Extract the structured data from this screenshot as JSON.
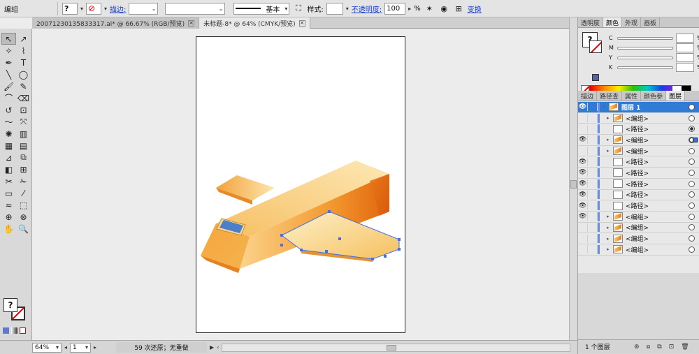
{
  "control_bar": {
    "selection_type": "编组",
    "fill_icon": "question-mark",
    "stroke_label": "描边:",
    "stroke_value": "",
    "stroke_profile_label": "基本",
    "style_label": "样式:",
    "opacity_label": "不透明度:",
    "opacity_value": "100",
    "opacity_unit": "%",
    "transform_label": "变换"
  },
  "tabs": [
    {
      "label": "20071230135833317.ai* @ 66.67% (RGB/预览)",
      "active": false
    },
    {
      "label": "未标题-8* @ 64% (CMYK/预览)",
      "active": true
    }
  ],
  "tools": [
    "selection-tool",
    "direct-selection-tool",
    "magic-wand-tool",
    "lasso-tool",
    "pen-tool",
    "type-tool",
    "line-tool",
    "ellipse-tool",
    "paintbrush-tool",
    "pencil-tool",
    "blob-brush-tool",
    "eraser-tool",
    "rotate-tool",
    "scale-tool",
    "warp-tool",
    "free-transform-tool",
    "symbol-sprayer-tool",
    "column-graph-tool",
    "mesh-tool",
    "gradient-tool",
    "eyedropper-tool",
    "blend-tool",
    "live-paint-bucket-tool",
    "live-paint-selection-tool",
    "slice-tool",
    "scissors-tool",
    "artboard-tool",
    "knife-tool",
    "width-tool",
    "shape-builder-tool",
    "perspective-grid-tool",
    "perspective-selection-tool",
    "hand-tool",
    "zoom-tool"
  ],
  "tool_glyphs": [
    "↖",
    "↗",
    "✧",
    "⌇",
    "✒",
    "T",
    "╲",
    "◯",
    "🖌",
    "✎",
    "⌒",
    "⌫",
    "↺",
    "⊡",
    "〜",
    "⤧",
    "✺",
    "▥",
    "▦",
    "▤",
    "⊿",
    "⧉",
    "◧",
    "⊞",
    "✂",
    "✁",
    "▭",
    "⁄",
    "≈",
    "⬚",
    "⊕",
    "⊗",
    "✋",
    "🔍"
  ],
  "fill_stroke": {
    "fill": "?",
    "stroke": "none"
  },
  "status": {
    "zoom": "64%",
    "artboard": "1",
    "undo_info": "59 次还原；无重做"
  },
  "panels": {
    "top_tabs": [
      {
        "label": "透明度",
        "active": false
      },
      {
        "label": "颜色",
        "active": true
      },
      {
        "label": "外观",
        "active": false
      },
      {
        "label": "画板",
        "active": false
      }
    ],
    "color_channels": [
      {
        "name": "C",
        "value": "",
        "unit": "%"
      },
      {
        "name": "M",
        "value": "",
        "unit": "%"
      },
      {
        "name": "Y",
        "value": "",
        "unit": "%"
      },
      {
        "name": "K",
        "value": "",
        "unit": "%"
      }
    ],
    "layer_tabs": [
      {
        "label": "描边",
        "active": false
      },
      {
        "label": "路径查",
        "active": false
      },
      {
        "label": "属性",
        "active": false
      },
      {
        "label": "颜色参",
        "active": false
      },
      {
        "label": "图层",
        "active": true
      }
    ],
    "layers": [
      {
        "name": "图层 1",
        "top": true,
        "visible": true,
        "expanded": true,
        "target": "outline"
      },
      {
        "name": "<编组>",
        "visible": false,
        "expandable": true,
        "target": "outline"
      },
      {
        "name": "<路径>",
        "visible": false,
        "expandable": false,
        "target": "filled"
      },
      {
        "name": "<编组>",
        "visible": true,
        "expandable": true,
        "target": "selected"
      },
      {
        "name": "<编组>",
        "visible": false,
        "expandable": true,
        "target": "outline"
      },
      {
        "name": "<路径>",
        "visible": true,
        "expandable": false,
        "target": "outline"
      },
      {
        "name": "<路径>",
        "visible": true,
        "expandable": false,
        "target": "outline"
      },
      {
        "name": "<路径>",
        "visible": true,
        "expandable": false,
        "target": "outline"
      },
      {
        "name": "<路径>",
        "visible": true,
        "expandable": false,
        "target": "outline"
      },
      {
        "name": "<路径>",
        "visible": true,
        "expandable": false,
        "target": "outline"
      },
      {
        "name": "<编组>",
        "visible": true,
        "expandable": true,
        "target": "outline"
      },
      {
        "name": "<编组>",
        "visible": false,
        "expandable": true,
        "target": "outline"
      },
      {
        "name": "<编组>",
        "visible": false,
        "expandable": true,
        "target": "outline"
      },
      {
        "name": "<编组>",
        "visible": false,
        "expandable": true,
        "target": "outline"
      }
    ],
    "layer_count": "1 个图层"
  },
  "colors": {
    "selection_blue": "#4a6fe3",
    "plane_orange": "#e98a1e",
    "plane_light": "#fbe3a6",
    "window_blue": "#4b7fc9"
  }
}
